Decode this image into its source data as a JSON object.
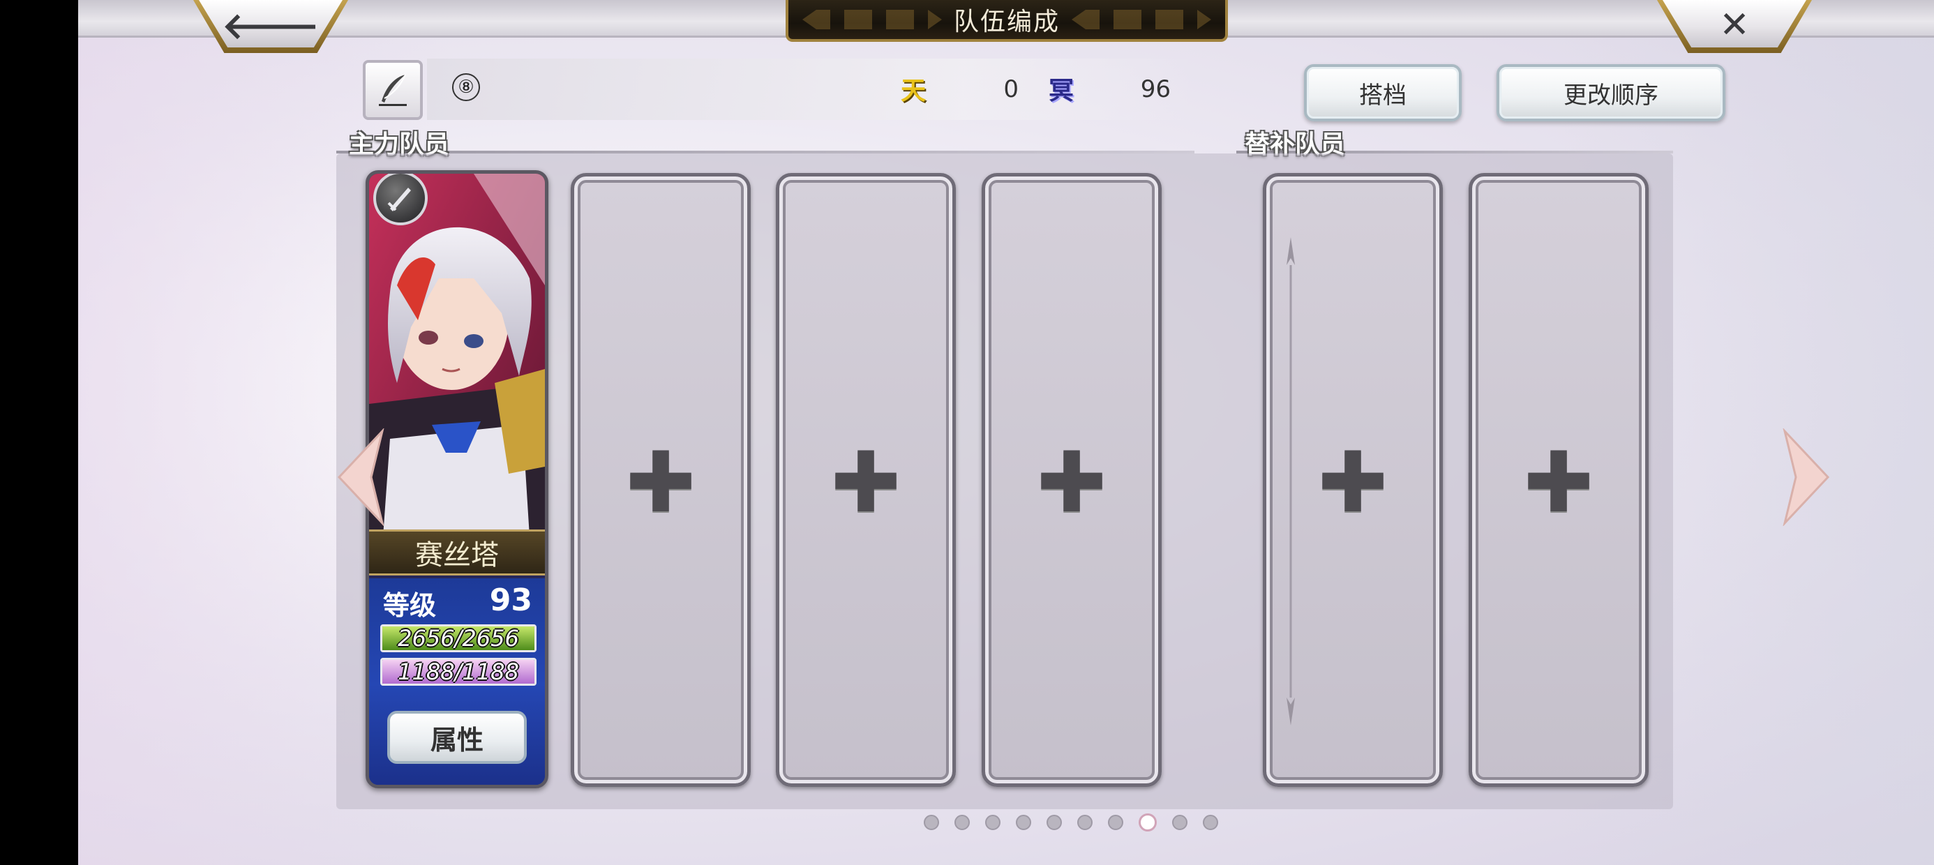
{
  "header": {
    "title": "队伍编成",
    "back_glyph": "🡐",
    "close_glyph": "✕"
  },
  "toolbar": {
    "team_number": "⑧",
    "heaven_icon": "天",
    "heaven_value": "0",
    "nether_icon": "冥",
    "nether_value": "96",
    "partner_label": "搭档",
    "order_label": "更改顺序"
  },
  "sections": {
    "main_label": "主力队员",
    "sub_label": "替补队员"
  },
  "character": {
    "name": "赛丝塔",
    "level_label": "等级",
    "level": "93",
    "hp": "2656/2656",
    "hp_fraction": 1.0,
    "mp": "1188/1188",
    "mp_fraction": 1.0,
    "attr_label": "属性",
    "weapon_icon": "sword-icon"
  },
  "empty_slot_glyph": "✚",
  "pagination": {
    "total": 10,
    "current": 8
  },
  "colors": {
    "gold": "#a0823e",
    "heaven": "#e9c21a",
    "nether": "#2b2a8a",
    "hp": "#6aa82a",
    "mp": "#c98ae0"
  }
}
